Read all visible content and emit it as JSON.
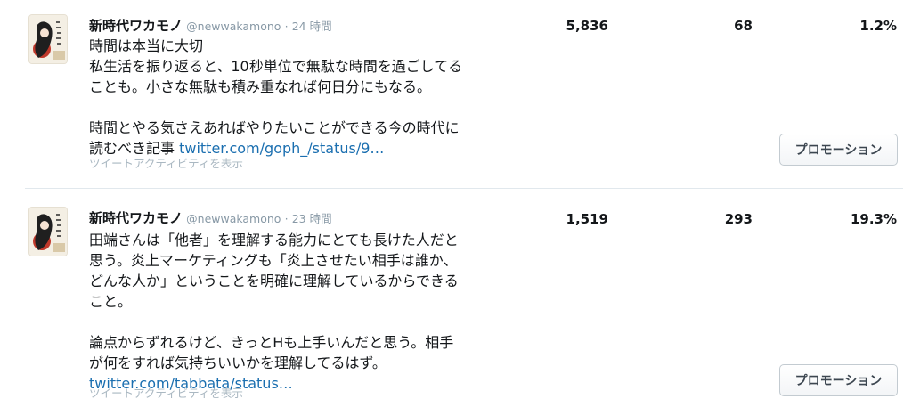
{
  "tweets": [
    {
      "display_name": "新時代ワカモノ",
      "handle": "@newwakamono",
      "separator": "·",
      "time": "24 時間",
      "lines_p1": [
        "時間は本当に大切",
        "私生活を振り返ると、10秒単位で無駄な時間を過ごしてる",
        "ことも。小さな無駄も積み重なれば何日分にもなる。"
      ],
      "lines_p2": [
        "時間とやる気さえあればやりたいことができる今の時代に"
      ],
      "last_line_prefix": "読むべき記事 ",
      "link": "twitter.com/goph_/status/9…",
      "activity": "ツイートアクティビティを表示",
      "impressions": "5,836",
      "engagements": "68",
      "engagement_rate": "1.2%",
      "promote_label": "プロモーション"
    },
    {
      "display_name": "新時代ワカモノ",
      "handle": "@newwakamono",
      "separator": "·",
      "time": "23 時間",
      "lines_p1": [
        "田端さんは「他者」を理解する能力にとても長けた人だと",
        "思う。炎上マーケティングも「炎上させたい相手は誰か、",
        "どんな人か」ということを明確に理解しているからできる",
        "こと。"
      ],
      "lines_p2": [
        "論点からずれるけど、きっとHも上手いんだと思う。相手",
        "が何をすれば気持ちいいかを理解してるはず。"
      ],
      "last_line_prefix": "",
      "link": "twitter.com/tabbata/status…",
      "activity": "ツイートアクティビティを表示",
      "impressions": "1,519",
      "engagements": "293",
      "engagement_rate": "19.3%",
      "promote_label": "プロモーション"
    }
  ],
  "colors": {
    "link": "#1b6fb0",
    "muted": "#8899a6",
    "divider": "#e1e8ed",
    "text": "#14171a"
  },
  "icons": {
    "avatar": "profile-avatar-illustration"
  }
}
